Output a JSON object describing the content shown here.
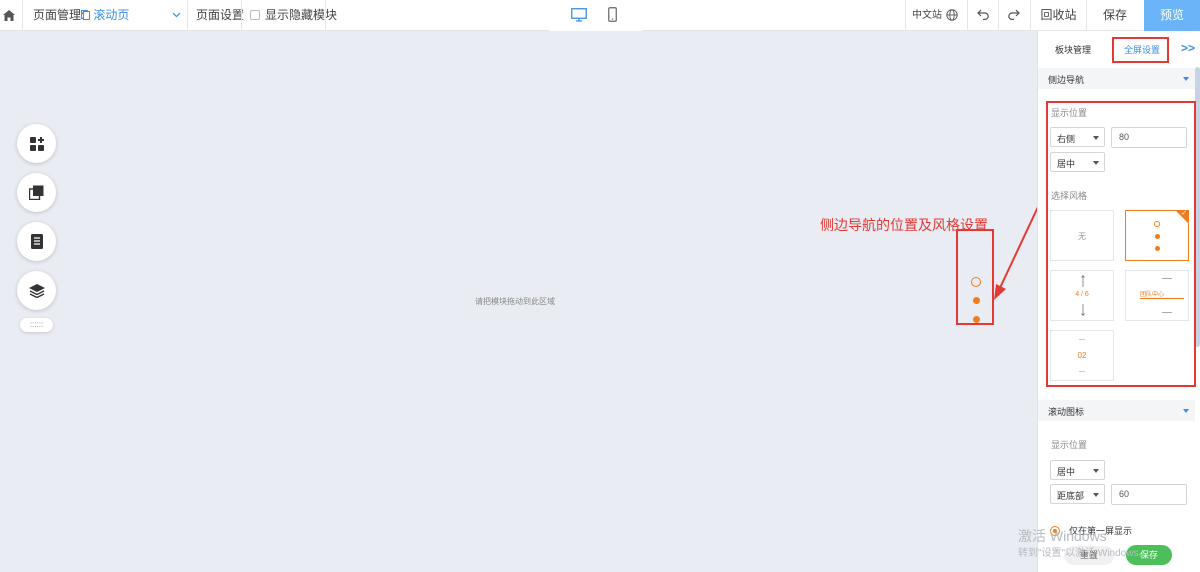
{
  "topbar": {
    "page_manage_label": "页面管理:",
    "current_page": "滚动页",
    "page_settings": "页面设置",
    "show_hidden_modules": "显示隐藏模块",
    "site_language": "中文站",
    "recycle_bin": "回收站",
    "save": "保存",
    "preview": "预览"
  },
  "canvas": {
    "drop_hint": "请把模块拖动到此区域",
    "handle_glyph": "::::::",
    "annotation": "侧边导航的位置及风格设置"
  },
  "watermark": {
    "line1": "激活 Windows",
    "line2": "转到\"设置\"以激活 Windows。"
  },
  "panel": {
    "tabs": [
      "板块管理",
      "全屏设置"
    ],
    "collapse_glyph": ">>",
    "side_nav": {
      "title": "侧边导航",
      "position_label": "显示位置",
      "horizontal_select": "右侧",
      "offset_value": "80",
      "vertical_select": "居中",
      "style_label": "选择风格",
      "styles": [
        {
          "label": "无"
        },
        {
          "label": ""
        },
        {
          "label": "4 / 6"
        },
        {
          "label": "团队中心"
        },
        {
          "label": "02"
        }
      ]
    },
    "scroll_icon": {
      "title": "滚动图标",
      "position_label": "显示位置",
      "align_select": "居中",
      "distance_select": "距底部",
      "distance_value": "60",
      "only_first_screen": "仅在第一屏显示"
    },
    "footer": {
      "reset": "重置",
      "save": "保存"
    }
  },
  "colors": {
    "accent_blue": "#3a8ee6",
    "accent_orange": "#f07c1e",
    "annotation_red": "#e53935",
    "save_green": "#4cbf5a"
  }
}
